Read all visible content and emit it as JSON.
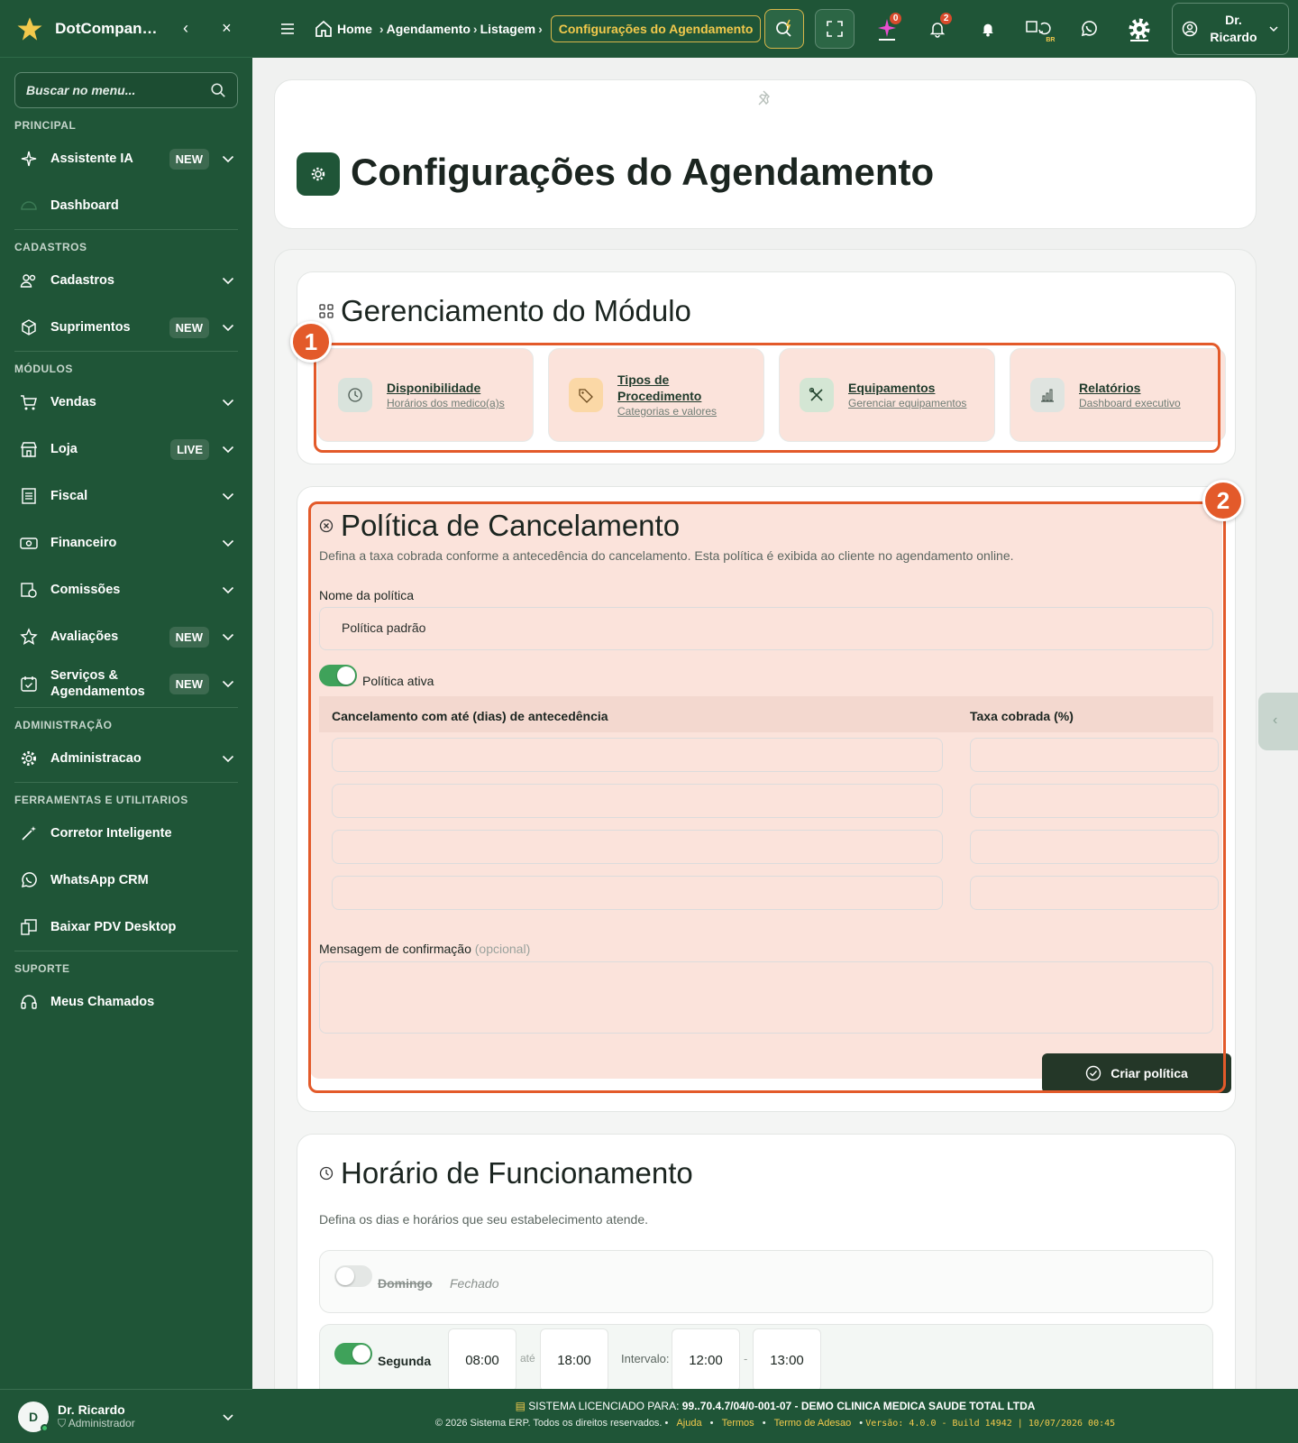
{
  "brand": {
    "name": "DotCompan…"
  },
  "search": {
    "placeholder": "Buscar no menu..."
  },
  "sidebar": {
    "sections": [
      {
        "title": "PRINCIPAL",
        "items": [
          {
            "label": "Assistente IA",
            "badge": "NEW",
            "icon": "sparkle-icon"
          },
          {
            "label": "Dashboard",
            "badge": "",
            "icon": "dashboard-icon"
          }
        ]
      },
      {
        "title": "CADASTROS",
        "items": [
          {
            "label": "Cadastros",
            "badge": "",
            "icon": "users-icon"
          },
          {
            "label": "Suprimentos",
            "badge": "NEW",
            "icon": "box-icon"
          }
        ]
      },
      {
        "title": "MÓDULOS",
        "items": [
          {
            "label": "Vendas",
            "badge": "",
            "icon": "cart-icon"
          },
          {
            "label": "Loja",
            "badge": "LIVE",
            "icon": "store-icon"
          },
          {
            "label": "Fiscal",
            "badge": "",
            "icon": "document-icon"
          },
          {
            "label": "Financeiro",
            "badge": "",
            "icon": "money-icon"
          },
          {
            "label": "Comissões",
            "badge": "",
            "icon": "commission-icon"
          },
          {
            "label": "Avaliações",
            "badge": "NEW",
            "icon": "star-icon"
          },
          {
            "label": "Serviços & Agendamentos",
            "badge": "NEW",
            "icon": "calendar-icon"
          }
        ]
      },
      {
        "title": "ADMINISTRAÇÃO",
        "items": [
          {
            "label": "Administracao",
            "badge": "",
            "icon": "gear-icon"
          }
        ]
      },
      {
        "title": "FERRAMENTAS E UTILITARIOS",
        "items": [
          {
            "label": "Corretor Inteligente",
            "badge": "",
            "icon": "magic-wand-icon"
          },
          {
            "label": "WhatsApp CRM",
            "badge": "",
            "icon": "whatsapp-icon"
          },
          {
            "label": "Baixar PDV Desktop",
            "badge": "",
            "icon": "download-desktop-icon"
          }
        ]
      },
      {
        "title": "SUPORTE",
        "items": [
          {
            "label": "Meus Chamados",
            "badge": "",
            "icon": "headset-icon"
          }
        ]
      }
    ],
    "user": {
      "initial": "D",
      "name": "Dr. Ricardo",
      "role": "Administrador"
    }
  },
  "topbar": {
    "breadcrumbs": [
      "Home",
      "Agendamento",
      "Listagem"
    ],
    "active_crumb": "Configurações do Agendamento",
    "ai_count": "0",
    "notif_count": "2",
    "lang_badge": "BR",
    "user_name_1": "Dr.",
    "user_name_2": "Ricardo"
  },
  "page": {
    "title": "Configurações do Agendamento",
    "module_section": {
      "title": "Gerenciamento do Módulo",
      "cards": [
        {
          "title": "Disponibilidade",
          "subtitle": "Horários dos medico(a)s",
          "icon": "clock-icon"
        },
        {
          "title": "Tipos de Procedimento",
          "subtitle": "Categorias e valores",
          "icon": "tag-icon"
        },
        {
          "title": "Equipamentos",
          "subtitle": "Gerenciar equipamentos",
          "icon": "tools-icon"
        },
        {
          "title": "Relatórios",
          "subtitle": "Dashboard executivo",
          "icon": "chart-icon"
        }
      ]
    },
    "policy": {
      "title": "Política de Cancelamento",
      "description": "Defina a taxa cobrada conforme a antecedência do cancelamento. Esta política é exibida ao cliente no agendamento online.",
      "name_label": "Nome da política",
      "name_value": "Política padrão",
      "active_label": "Política ativa",
      "active": true,
      "col_days": "Cancelamento com até (dias) de antecedência",
      "col_fee": "Taxa cobrada (%)",
      "rows": [
        {
          "days": "",
          "fee": ""
        },
        {
          "days": "",
          "fee": ""
        },
        {
          "days": "",
          "fee": ""
        },
        {
          "days": "",
          "fee": ""
        }
      ],
      "message_label": "Mensagem de confirmação",
      "message_optional": "(opcional)",
      "message_value": "",
      "submit": "Criar política"
    },
    "hours": {
      "title": "Horário de Funcionamento",
      "description": "Defina os dias e horários que seu estabelecimento atende.",
      "days": [
        {
          "name": "Domingo",
          "open": false,
          "status": "Fechado"
        },
        {
          "name": "Segunda",
          "open": true,
          "start": "08:00",
          "until": "até",
          "end": "18:00",
          "interval_label": "Intervalo:",
          "break_start": "12:00",
          "dash": "-",
          "break_end": "13:00"
        }
      ]
    }
  },
  "annotations": {
    "one": "1",
    "two": "2"
  },
  "footer": {
    "license_label": "SISTEMA LICENCIADO PARA:",
    "license_value": "99..70.4.7/04/0-001-07 - DEMO CLINICA MEDICA SAUDE TOTAL LTDA",
    "copyright": "© 2026 Sistema ERP. Todos os direitos reservados.",
    "links": [
      "Ajuda",
      "Termos",
      "Termo de Adesao"
    ],
    "version": "Versão: 4.0.0 - Build 14942 | 10/07/2026 00:45"
  },
  "colors": {
    "primary": "#1f5537",
    "accent": "#e35a2a",
    "highlight_bg": "#fbe3db",
    "gold": "#f2c94c"
  }
}
